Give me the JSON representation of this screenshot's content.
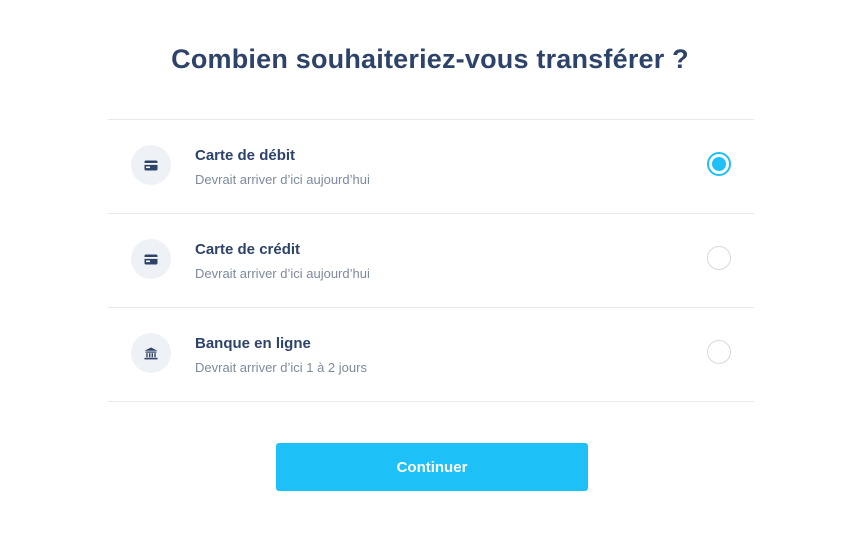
{
  "title": "Combien souhaiteriez-vous transférer ?",
  "options": [
    {
      "title": "Carte de débit",
      "subtitle": "Devrait arriver d’ici aujourd’hui",
      "icon": "credit-card-icon",
      "selected": true
    },
    {
      "title": "Carte de crédit",
      "subtitle": "Devrait arriver d’ici aujourd’hui",
      "icon": "credit-card-icon",
      "selected": false
    },
    {
      "title": "Banque en ligne",
      "subtitle": "Devrait arriver d’ici 1 à 2 jours",
      "icon": "bank-icon",
      "selected": false
    }
  ],
  "continue_label": "Continuer",
  "colors": {
    "accent": "#1ec0f8",
    "heading": "#2e4369",
    "subtext": "#7d8a9e",
    "divider": "#e6e9ee"
  }
}
